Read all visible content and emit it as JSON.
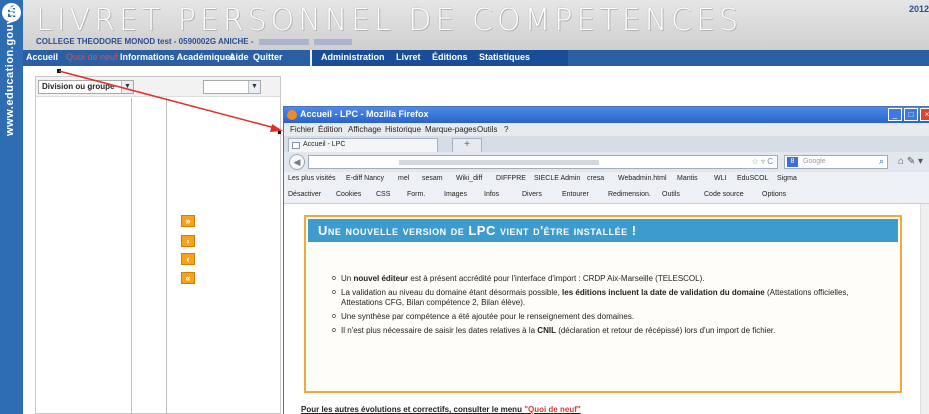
{
  "app": {
    "logo_letter": "É",
    "vertical_text": "www.education.gouv.fr",
    "title": "LIVRET PERSONNEL DE COMPETENCES",
    "school_line": "COLLEGE THEODORE MONOD test - 0590002G ANICHE -",
    "year": "2012"
  },
  "menu": {
    "items": [
      "Accueil",
      "Quoi de neuf",
      "Informations Académiques",
      "Aide",
      "Quitter",
      "Administration",
      "Livret",
      "Éditions",
      "Statistiques"
    ]
  },
  "left_panel": {
    "select_label": "Division ou groupe",
    "arrows": [
      "»",
      "›",
      "‹",
      "«"
    ]
  },
  "firefox": {
    "title": "Accueil - LPC - Mozilla Firefox",
    "menus": [
      "Fichier",
      "Édition",
      "Affichage",
      "Historique",
      "Marque-pages",
      "Outils",
      "?"
    ],
    "tab_label": "Accueil - LPC",
    "new_tab": "+",
    "search_placeholder": "Google",
    "bookmarks": [
      "Les plus visités",
      "E-diff Nancy",
      "mel",
      "sesam",
      "Wiki_diff",
      "DIFFPRE",
      "SIECLE Admin",
      "cresa",
      "Webadmin.html",
      "Mantis",
      "WLI",
      "EduSCOL",
      "Sigma"
    ],
    "webdev": [
      "Désactiver",
      "Cookies",
      "CSS",
      "Form.",
      "Images",
      "Infos",
      "Divers",
      "Entourer",
      "Redimension.",
      "Outils",
      "Code source",
      "Options"
    ]
  },
  "notice": {
    "heading": "Une nouvelle version de LPC vient d'être installée !",
    "items": [
      {
        "pre": "Un ",
        "bold": "nouvel éditeur",
        "post": " est à présent accrédité pour l'interface d'import : CRDP Aix-Marseille (TELESCOL)."
      },
      {
        "pre": "La validation au niveau du domaine étant désormais possible, ",
        "bold": "les éditions incluent la date de validation du domaine",
        "post": " (Attestations officielles, Attestations CFG, Bilan compétence 2, Bilan élève)."
      },
      {
        "pre": "Une synthèse par compétence a été ajoutée pour le renseignement des domaines.",
        "bold": "",
        "post": ""
      },
      {
        "pre": "Il n'est plus nécessaire de saisir les dates relatives à la ",
        "bold": "CNIL",
        "post": " (déclaration et retour de récépissé) lors d'un import de fichier."
      }
    ],
    "footer_text": "Pour les autres évolutions et correctifs, consulter le menu ",
    "footer_link": "\"Quoi de neuf\""
  }
}
